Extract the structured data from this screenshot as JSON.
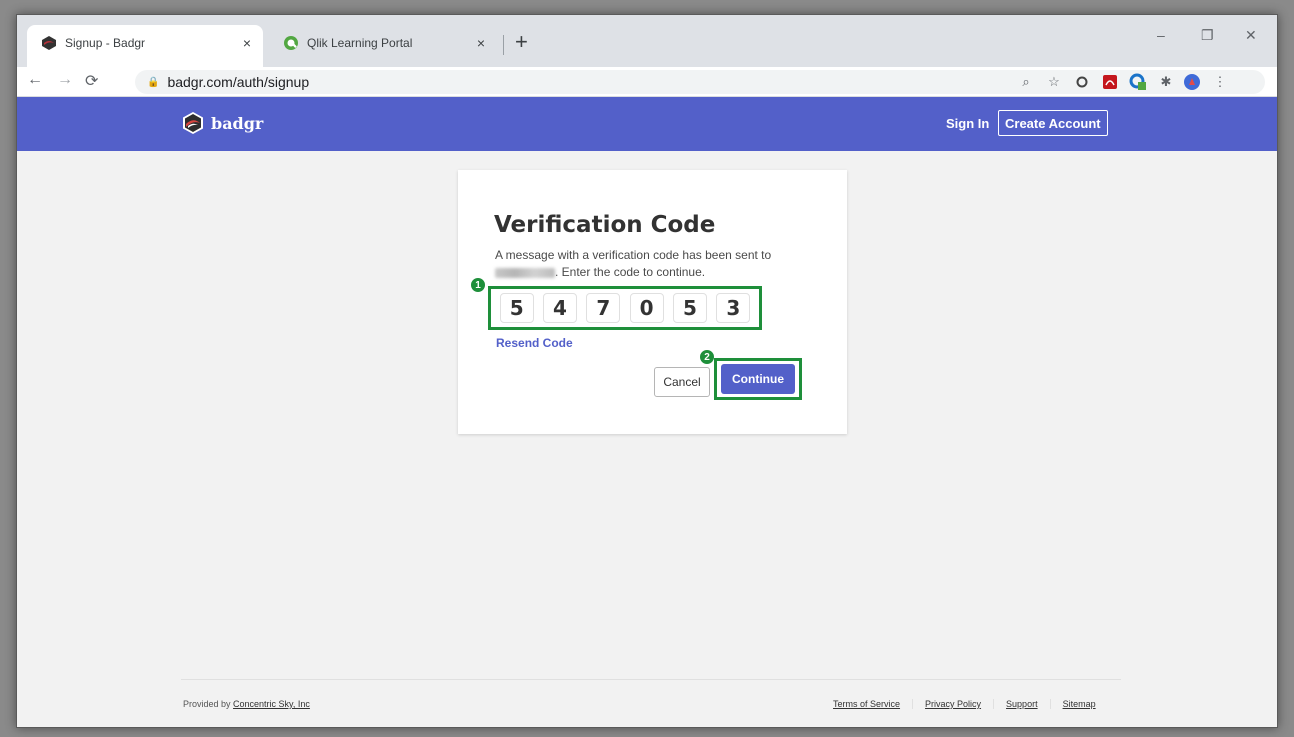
{
  "browser": {
    "tabs": [
      {
        "title": "Signup - Badgr",
        "close": "×",
        "active": true
      },
      {
        "title": "Qlik Learning Portal",
        "close": "×",
        "active": false
      }
    ],
    "new_tab": "+",
    "url": "badgr.com/auth/signup",
    "window_controls": {
      "minimize": "–",
      "restore": "❐",
      "close": "✕"
    }
  },
  "site": {
    "brand": "badgr",
    "nav": {
      "sign_in": "Sign In",
      "create_account": "Create Account"
    }
  },
  "card": {
    "title": "Verification Code",
    "message_line1": "A message with a verification code has been sent to",
    "message_line2": ". Enter the code to continue.",
    "code_digits": [
      "5",
      "4",
      "7",
      "0",
      "5",
      "3"
    ],
    "resend": "Resend Code",
    "cancel": "Cancel",
    "continue": "Continue",
    "annotations": [
      "1",
      "2"
    ]
  },
  "footer": {
    "provided_by": "Provided by ",
    "company": "Concentric Sky, Inc",
    "links": [
      "Terms of Service",
      "Privacy Policy",
      "Support",
      "Sitemap"
    ]
  },
  "colors": {
    "header": "#5360c9",
    "highlight": "#1e8f3a",
    "qlik_green": "#52a742",
    "badgr_red": "#b8323b"
  }
}
